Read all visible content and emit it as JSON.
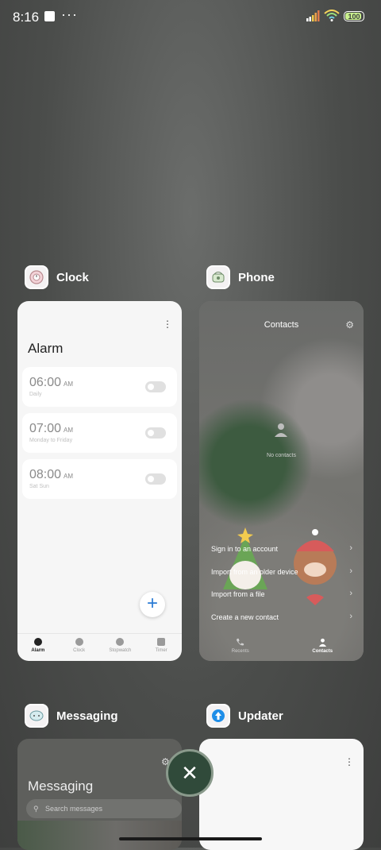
{
  "status_bar": {
    "time": "8:16",
    "more": "···",
    "battery": "100"
  },
  "recents": {
    "clock": {
      "app_name": "Clock",
      "screen_title": "Alarm",
      "alarms": [
        {
          "time": "06:00",
          "ampm": "AM",
          "repeat": "Daily"
        },
        {
          "time": "07:00",
          "ampm": "AM",
          "repeat": "Monday to Friday"
        },
        {
          "time": "08:00",
          "ampm": "AM",
          "repeat": "Sat Sun"
        }
      ],
      "nav": [
        "Alarm",
        "Clock",
        "Stopwatch",
        "Timer"
      ]
    },
    "phone": {
      "app_name": "Phone",
      "screen_title": "Contacts",
      "empty_text": "No contacts",
      "menu": [
        "Sign in to an account",
        "Import from an older device",
        "Import from a file",
        "Create a new contact"
      ],
      "nav": [
        "Recents",
        "Contacts"
      ]
    },
    "messaging": {
      "app_name": "Messaging",
      "screen_title": "Messaging",
      "search_placeholder": "Search messages"
    },
    "updater": {
      "app_name": "Updater"
    }
  },
  "close_all_label": "✕",
  "colors": {
    "fab_blue": "#2a7bd4",
    "close_bg": "#304a3a"
  }
}
